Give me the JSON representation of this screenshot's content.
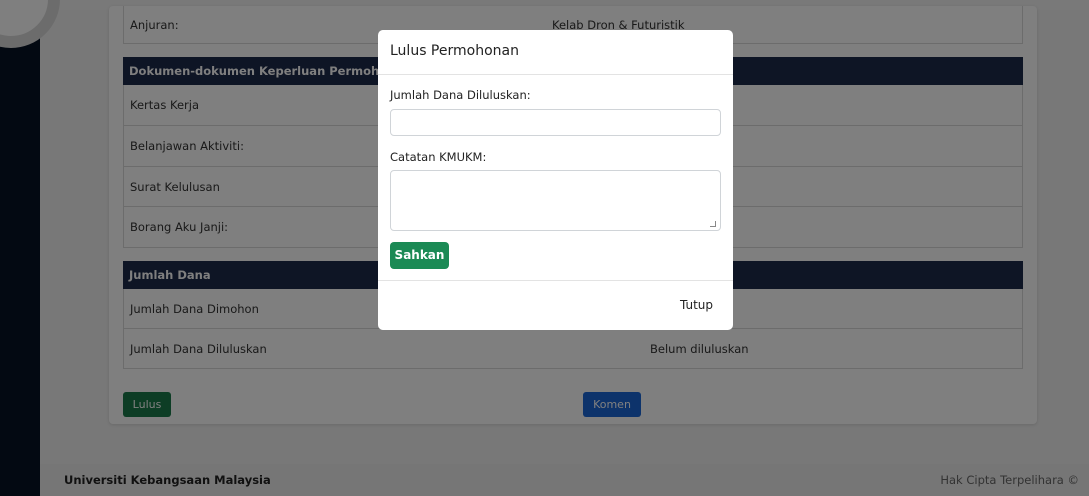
{
  "organizer": {
    "label": "Anjuran:",
    "value": "Kelab Dron & Futuristik"
  },
  "documents": {
    "header": "Dokumen-dokumen Keperluan Permohonan",
    "items": [
      {
        "label": "Kertas Kerja"
      },
      {
        "label": "Belanjawan Aktiviti:"
      },
      {
        "label": "Surat Kelulusan"
      },
      {
        "label": "Borang Aku Janji:"
      }
    ]
  },
  "funds": {
    "header": "Jumlah Dana",
    "requested_label": "Jumlah Dana Dimohon",
    "approved_label": "Jumlah Dana Diluluskan",
    "approved_value": "Belum diluluskan"
  },
  "actions": {
    "approve": "Lulus",
    "comment": "Komen"
  },
  "footer": {
    "left": "Universiti Kebangsaan Malaysia",
    "right": "Hak Cipta Terpelihara ©"
  },
  "modal": {
    "title": "Lulus Permohonan",
    "amount_label": "Jumlah Dana Diluluskan:",
    "amount_value": "",
    "note_label": "Catatan KMUKM:",
    "note_value": "",
    "confirm": "Sahkan",
    "close": "Tutup"
  },
  "colors": {
    "sidebar": "#061325",
    "table_header": "#1d2a4a",
    "approve_button": "#1a7a4a",
    "comment_button": "#1a66d6",
    "confirm_button": "#1b8a55"
  }
}
